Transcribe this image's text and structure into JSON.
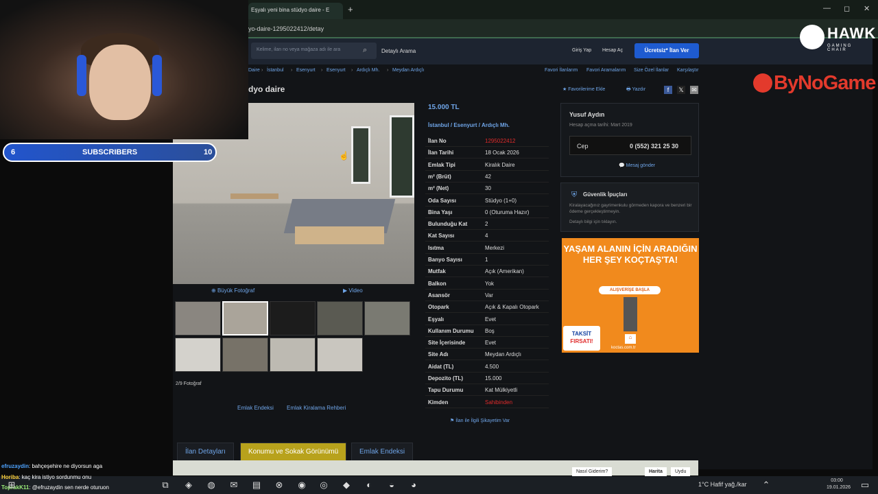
{
  "browser": {
    "tab_title": "Eşyalı yeni bina stüdyo daire - E",
    "new_tab": "+",
    "url": "yo-daire-1295022412/detay",
    "win_min": "—",
    "win_max": "◻",
    "win_close": "✕"
  },
  "site": {
    "search_placeholder": "Kelime, ilan no veya mağaza adı ile ara",
    "detailed_search": "Detaylı Arama",
    "login": "Giriş Yap",
    "register": "Hesap Aç",
    "post_ad": "Ücretsiz* İlan Ver"
  },
  "breadcrumb": [
    "Daire",
    "İstanbul",
    "Esenyurt",
    "Esenyurt",
    "Ardıçlı Mh.",
    "Meydan Ardıçlı"
  ],
  "top_links": [
    "Favori İlanlarım",
    "Favori Aramalarım",
    "Size Özel İlanlar",
    "Karşılaştır"
  ],
  "listing": {
    "title": "dyo daire",
    "favorite": "Favorilerime Ekle",
    "print": "Yazdır",
    "price": "15.000 TL",
    "location": "İstanbul  /  Esenyurt  /  Ardıçlı Mh.",
    "big_photo": "Büyük Fotoğraf",
    "video": "Video",
    "photo_count": "2/9 Fotoğraf",
    "complaint": "İlan ile İlgili Şikayetim Var",
    "links": [
      "Emlak Endeksi",
      "Emlak Kiralama Rehberi"
    ]
  },
  "details": [
    {
      "k": "İlan No",
      "v": "1295022412",
      "red": true
    },
    {
      "k": "İlan Tarihi",
      "v": "18 Ocak 2026"
    },
    {
      "k": "Emlak Tipi",
      "v": "Kiralık Daire"
    },
    {
      "k": "m² (Brüt)",
      "v": "42"
    },
    {
      "k": "m² (Net)",
      "v": "30"
    },
    {
      "k": "Oda Sayısı",
      "v": "Stüdyo (1+0)"
    },
    {
      "k": "Bina Yaşı",
      "v": "0 (Oturuma Hazır)"
    },
    {
      "k": "Bulunduğu Kat",
      "v": "2"
    },
    {
      "k": "Kat Sayısı",
      "v": "4"
    },
    {
      "k": "Isıtma",
      "v": "Merkezi"
    },
    {
      "k": "Banyo Sayısı",
      "v": "1"
    },
    {
      "k": "Mutfak",
      "v": "Açık (Amerikan)"
    },
    {
      "k": "Balkon",
      "v": "Yok"
    },
    {
      "k": "Asansör",
      "v": "Var"
    },
    {
      "k": "Otopark",
      "v": "Açık & Kapalı Otopark"
    },
    {
      "k": "Eşyalı",
      "v": "Evet"
    },
    {
      "k": "Kullanım Durumu",
      "v": "Boş"
    },
    {
      "k": "Site İçerisinde",
      "v": "Evet"
    },
    {
      "k": "Site Adı",
      "v": "Meydan Ardıçlı"
    },
    {
      "k": "Aidat (TL)",
      "v": "4.500"
    },
    {
      "k": "Depozito (TL)",
      "v": "15.000"
    },
    {
      "k": "Tapu Durumu",
      "v": "Kat Mülkiyetli"
    },
    {
      "k": "Kimden",
      "v": "Sahibinden",
      "red": true
    }
  ],
  "seller": {
    "name": "Yusuf Aydın",
    "since": "Hesap açma tarihi: Mart 2019",
    "phone_label": "Cep",
    "phone": "0 (552) 321 25 30",
    "message": "Mesaj gönder"
  },
  "safety": {
    "title": "Güvenlik İpuçları",
    "body": "Kiralayacağınız gayrimenkulu görmeden kapora ve benzeri bir ödeme gerçekleştirmeyin.",
    "more": "Detaylı bilgi için tıklayın."
  },
  "ad": {
    "headline": "YAŞAM ALANIN İÇİN ARADIĞIN HER ŞEY KOÇTAŞ'TA!",
    "cta": "ALIŞVERİŞE BAŞLA",
    "badge1": "TAKSİT",
    "badge2": "FIRSATI!",
    "url": "koctas.com.tr"
  },
  "bottom_tabs": [
    "İlan Detayları",
    "Konumu ve Sokak Görünümü",
    "Emlak Endeksi"
  ],
  "map": {
    "ask": "Nasıl Giderim?",
    "map": "Harita",
    "sat": "Uydu"
  },
  "stream": {
    "subs_left": "6",
    "subs_label": "SUBSCRIBERS",
    "subs_right": "10",
    "hawk": "HAWK",
    "hawk_sub": "GAMING CHAIR",
    "bng": "ByNoGame",
    "chat": [
      {
        "user": "efruzaydin",
        "msg": ": bahçeşehire ne diyorsun aga",
        "color": "#4ea3ff"
      },
      {
        "user": "Horiba",
        "msg": ": kaç kira istiyo sordunmu onu",
        "color": "#ffd23a"
      },
      {
        "user": "ToprakK11",
        "msg": ": @efruzaydin sen nerde oturuon",
        "color": "#9df07a"
      }
    ]
  },
  "taskbar": {
    "weather": "1°C  Hafif yağ./kar",
    "time": "03:00",
    "date": "19.01.2026"
  }
}
